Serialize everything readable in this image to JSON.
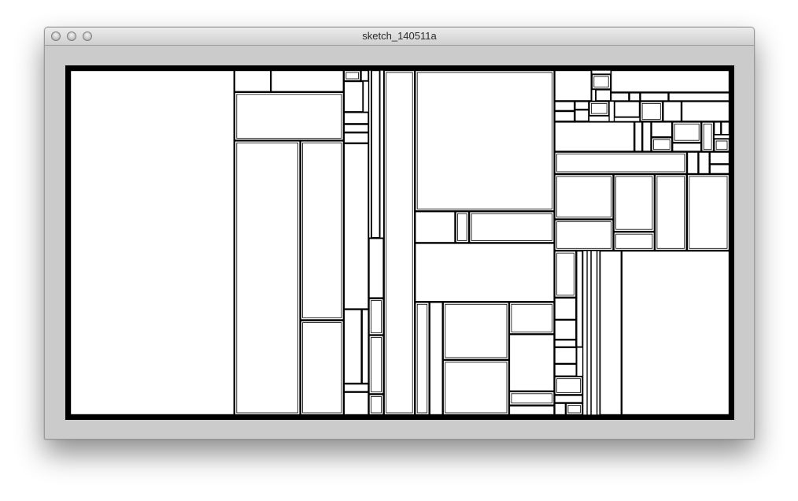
{
  "window": {
    "title": "sketch_140511a",
    "controls": [
      "close-button",
      "minimize-button",
      "zoom-button"
    ]
  },
  "canvas": {
    "background": "#000000",
    "foreground": "#ffffff",
    "window_background": "#cbcbcb"
  }
}
